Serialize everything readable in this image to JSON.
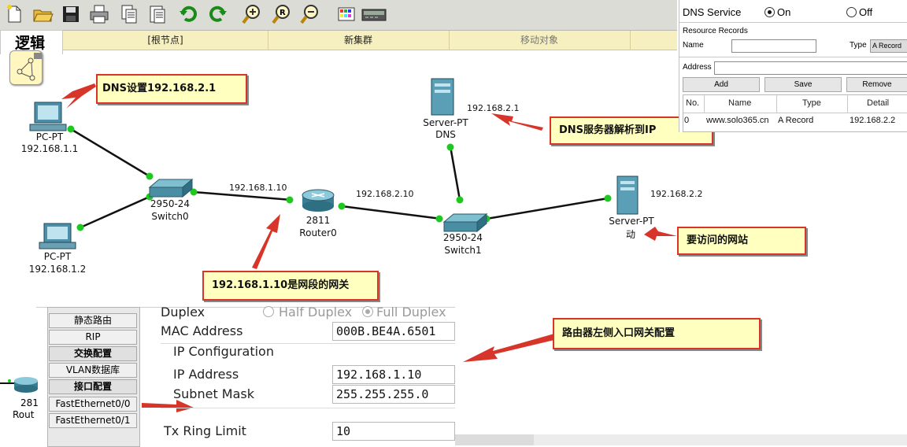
{
  "toolbar": {
    "icons": [
      "new-file-icon",
      "open-folder-icon",
      "save-icon",
      "print-icon",
      "copy-icon",
      "paste-icon",
      "undo-icon",
      "redo-icon",
      "zoom-in-icon",
      "zoom-reset-icon",
      "zoom-out-icon",
      "palette-icon",
      "device-icon"
    ]
  },
  "logic_bar": {
    "tab_label": "逻辑",
    "root_node": "[根节点]",
    "new_cluster": "新集群",
    "move_object": "移动对象"
  },
  "topology": {
    "pc1": {
      "name": "PC-PT",
      "ip": "192.168.1.1"
    },
    "pc2": {
      "name": "PC-PT",
      "ip": "192.168.1.2"
    },
    "switch0": {
      "model": "2950-24",
      "name": "Switch0"
    },
    "router0": {
      "model": "2811",
      "name": "Router0"
    },
    "switch1": {
      "model": "2950-24",
      "name": "Switch1"
    },
    "server_dns": {
      "model": "Server-PT",
      "name": "DNS",
      "ip": "192.168.2.1"
    },
    "server_web": {
      "model": "Server-PT",
      "name": "动",
      "ip": "192.168.2.2"
    },
    "link_labels": {
      "router_left": "192.168.1.10",
      "router_right": "192.168.2.10"
    }
  },
  "callouts": {
    "dns_setting": "DNS设置192.168.2.1",
    "dns_resolve": "DNS服务器解析到IP",
    "website": "要访问的网站",
    "gateway": "192.168.1.10是网段的网关",
    "router_port": "路由器左侧入口网关配置"
  },
  "dns_panel": {
    "service_label": "DNS Service",
    "on_label": "On",
    "off_label": "Off",
    "resource_records": "Resource Records",
    "name_label": "Name",
    "type_label": "Type",
    "type_value": "A Record",
    "address_label": "Address",
    "buttons": {
      "add": "Add",
      "save": "Save",
      "remove": "Remove"
    },
    "table_headers": [
      "No.",
      "Name",
      "Type",
      "Detail"
    ],
    "rows": [
      [
        "0",
        "www.solo365.cn",
        "A Record",
        "192.168.2.2"
      ]
    ]
  },
  "router_config": {
    "nav": [
      "静态路由",
      "RIP",
      "交换配置",
      "VLAN数据库",
      "接口配置",
      "FastEthernet0/0",
      "FastEthernet0/1"
    ],
    "device_model": "281",
    "device_name": "Rout",
    "duplex_label": "Duplex",
    "half_duplex": "Half Duplex",
    "full_duplex": "Full Duplex",
    "mac_label": "MAC Address",
    "mac_value": "000B.BE4A.6501",
    "ip_config_label": "IP Configuration",
    "ip_label": "IP Address",
    "ip_value": "192.168.1.10",
    "mask_label": "Subnet Mask",
    "mask_value": "255.255.255.0",
    "tx_label": "Tx Ring Limit",
    "tx_value": "10"
  },
  "colors": {
    "accent_red": "#d8352a",
    "callout_bg": "#ffffc0",
    "link_green": "#1ec81e",
    "logic_bar": "#f6efc0"
  }
}
